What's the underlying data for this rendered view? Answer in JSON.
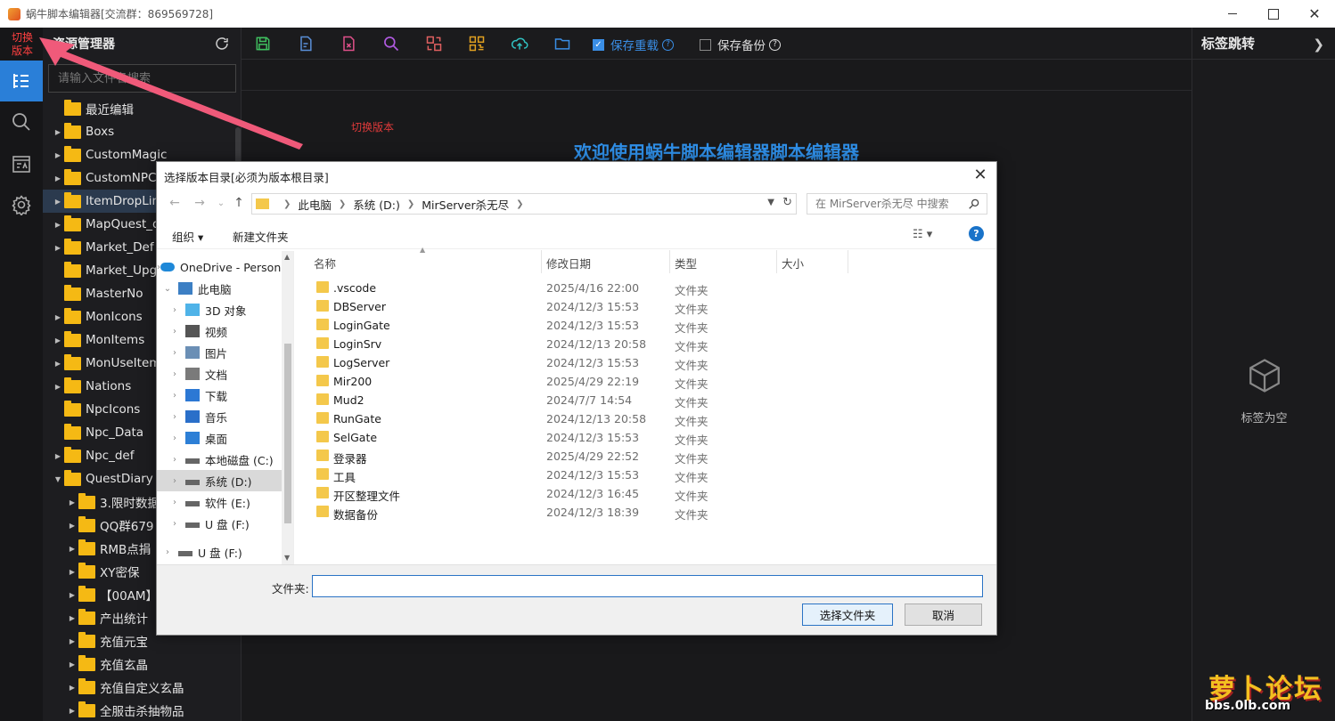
{
  "window": {
    "title": "蜗牛脚本编辑器[交流群：869569728]"
  },
  "activity": {
    "switch_version": "切换\n版本"
  },
  "explorer": {
    "title": "资源管理器",
    "search_placeholder": "请输入文件名搜索",
    "items": [
      {
        "label": "最近编辑",
        "caret": ""
      },
      {
        "label": "Boxs",
        "caret": "▶"
      },
      {
        "label": "CustomMagic",
        "caret": "▶"
      },
      {
        "label": "CustomNPC",
        "caret": "▶"
      },
      {
        "label": "ItemDropLimit",
        "caret": "▶"
      },
      {
        "label": "MapQuest_def",
        "caret": "▶"
      },
      {
        "label": "Market_Def",
        "caret": "▶"
      },
      {
        "label": "Market_Upg",
        "caret": ""
      },
      {
        "label": "MasterNo",
        "caret": ""
      },
      {
        "label": "MonIcons",
        "caret": "▶"
      },
      {
        "label": "MonItems",
        "caret": "▶"
      },
      {
        "label": "MonUseItem",
        "caret": "▶"
      },
      {
        "label": "Nations",
        "caret": "▶"
      },
      {
        "label": "NpcIcons",
        "caret": ""
      },
      {
        "label": "Npc_Data",
        "caret": ""
      },
      {
        "label": "Npc_def",
        "caret": "▶"
      },
      {
        "label": "QuestDiary",
        "caret": "▼"
      },
      {
        "label": "3.限时数据",
        "caret": "▶"
      },
      {
        "label": "QQ群679",
        "caret": "▶"
      },
      {
        "label": "RMB点捐",
        "caret": "▶"
      },
      {
        "label": "XY密保",
        "caret": "▶"
      },
      {
        "label": "【00AM】",
        "caret": "▶"
      },
      {
        "label": "产出统计",
        "caret": "▶"
      },
      {
        "label": "充值元宝",
        "caret": "▶"
      },
      {
        "label": "充值玄晶",
        "caret": "▶"
      },
      {
        "label": "充值自定义玄晶",
        "caret": "▶"
      },
      {
        "label": "全服击杀抽物品",
        "caret": "▶"
      }
    ]
  },
  "toolbar": {
    "save_reload_label": "保存重载",
    "save_backup_label": "保存备份"
  },
  "editor": {
    "switch_version_label": "切换版本",
    "welcome": "欢迎使用蜗牛脚本编辑器脚本编辑器"
  },
  "right_panel": {
    "title": "标签跳转",
    "empty_label": "标签为空"
  },
  "dialog": {
    "title": "选择版本目录[必须为版本根目录]",
    "address": [
      "此电脑",
      "系统 (D:)",
      "MirServer杀无尽"
    ],
    "search_placeholder": "在 MirServer杀无尽 中搜索",
    "organize": "组织 ▾",
    "new_folder": "新建文件夹",
    "nav_items": [
      {
        "label": "OneDrive - Personal",
        "icon": "cloud-icon",
        "indent": 0
      },
      {
        "label": "此电脑",
        "icon": "computer-icon",
        "indent": 0
      },
      {
        "label": "3D 对象",
        "icon": "cube-icon",
        "indent": 1
      },
      {
        "label": "视频",
        "icon": "video-icon",
        "indent": 1
      },
      {
        "label": "图片",
        "icon": "image-icon",
        "indent": 1
      },
      {
        "label": "文档",
        "icon": "document-icon",
        "indent": 1
      },
      {
        "label": "下载",
        "icon": "download-icon",
        "indent": 1
      },
      {
        "label": "音乐",
        "icon": "music-icon",
        "indent": 1
      },
      {
        "label": "桌面",
        "icon": "desktop-icon",
        "indent": 1
      },
      {
        "label": "本地磁盘 (C:)",
        "icon": "drive-icon",
        "indent": 1
      },
      {
        "label": "系统 (D:)",
        "icon": "drive-icon",
        "indent": 1
      },
      {
        "label": "软件 (E:)",
        "icon": "drive-icon",
        "indent": 1
      },
      {
        "label": "U 盘 (F:)",
        "icon": "drive-icon",
        "indent": 1
      },
      {
        "label": "U 盘 (F:)",
        "icon": "drive-icon",
        "indent": 0
      }
    ],
    "columns": {
      "name": "名称",
      "date": "修改日期",
      "type": "类型",
      "size": "大小"
    },
    "files": [
      {
        "name": ".vscode",
        "date": "2025/4/16 22:00",
        "type": "文件夹"
      },
      {
        "name": "DBServer",
        "date": "2024/12/3 15:53",
        "type": "文件夹"
      },
      {
        "name": "LoginGate",
        "date": "2024/12/3 15:53",
        "type": "文件夹"
      },
      {
        "name": "LoginSrv",
        "date": "2024/12/13 20:58",
        "type": "文件夹"
      },
      {
        "name": "LogServer",
        "date": "2024/12/3 15:53",
        "type": "文件夹"
      },
      {
        "name": "Mir200",
        "date": "2025/4/29 22:19",
        "type": "文件夹"
      },
      {
        "name": "Mud2",
        "date": "2024/7/7 14:54",
        "type": "文件夹"
      },
      {
        "name": "RunGate",
        "date": "2024/12/13 20:58",
        "type": "文件夹"
      },
      {
        "name": "SelGate",
        "date": "2024/12/3 15:53",
        "type": "文件夹"
      },
      {
        "name": "登录器",
        "date": "2025/4/29 22:52",
        "type": "文件夹"
      },
      {
        "name": "工具",
        "date": "2024/12/3 15:53",
        "type": "文件夹"
      },
      {
        "name": "开区整理文件",
        "date": "2024/12/3 16:45",
        "type": "文件夹"
      },
      {
        "name": "数据备份",
        "date": "2024/12/3 18:39",
        "type": "文件夹"
      }
    ],
    "folder_label": "文件夹:",
    "folder_value": "",
    "select_button": "选择文件夹",
    "cancel_button": "取消"
  },
  "watermark": {
    "brand": "萝卜论坛",
    "url": "bbs.0lb.com"
  }
}
